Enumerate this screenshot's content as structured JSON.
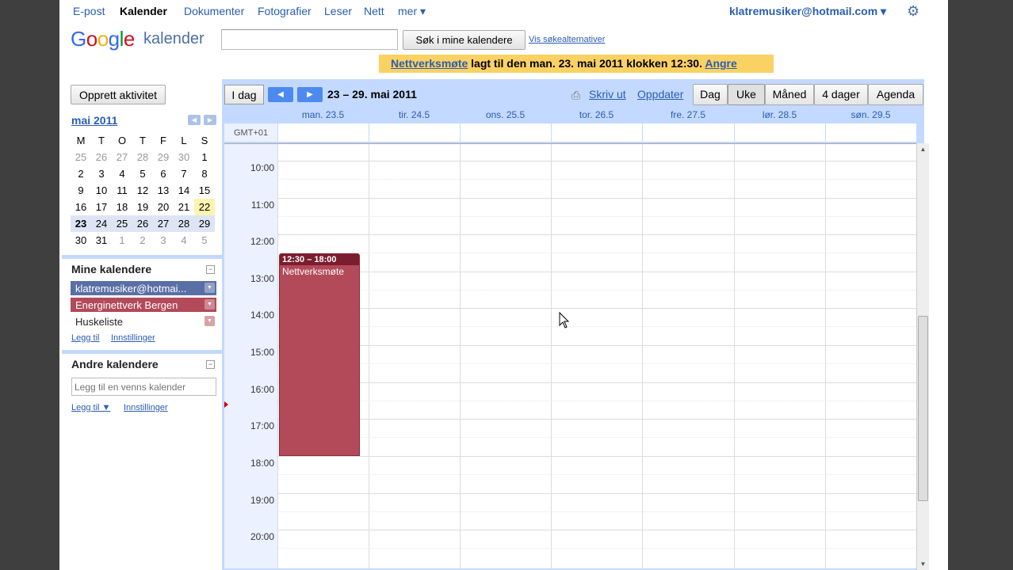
{
  "topnav": {
    "items": [
      "E-post",
      "Kalender",
      "Dokumenter",
      "Fotografier",
      "Leser",
      "Nett",
      "mer ▾"
    ],
    "account": "klatremusiker@hotmail.com ▾"
  },
  "header": {
    "logo": "Google",
    "product": "kalender",
    "search_placeholder": "",
    "search_button": "Søk i mine kalendere",
    "search_options": "Vis søkealternativer"
  },
  "notice": {
    "event_link": "Nettverksmøte",
    "text": " lagt til den man. 23. mai 2011 klokken 12:30. ",
    "undo": "Angre"
  },
  "sidebar": {
    "create_button": "Opprett aktivitet",
    "mini_cal": {
      "month": "mai 2011",
      "weekdays": [
        "M",
        "T",
        "O",
        "T",
        "F",
        "L",
        "S"
      ],
      "weeks": [
        [
          "25",
          "26",
          "27",
          "28",
          "29",
          "30",
          "1"
        ],
        [
          "2",
          "3",
          "4",
          "5",
          "6",
          "7",
          "8"
        ],
        [
          "9",
          "10",
          "11",
          "12",
          "13",
          "14",
          "15"
        ],
        [
          "16",
          "17",
          "18",
          "19",
          "20",
          "21",
          "22"
        ],
        [
          "23",
          "24",
          "25",
          "26",
          "27",
          "28",
          "29"
        ],
        [
          "30",
          "31",
          "1",
          "2",
          "3",
          "4",
          "5"
        ]
      ]
    },
    "my_calendars": {
      "title": "Mine kalendere",
      "items": [
        {
          "label": "klatremusiker@hotmai...",
          "color": "#5a6fa5"
        },
        {
          "label": "Energinettverk Bergen",
          "color": "#b24a5a"
        },
        {
          "label": "Huskeliste",
          "color": "#ffffff"
        }
      ],
      "add": "Legg til",
      "settings": "Innstillinger"
    },
    "other_calendars": {
      "title": "Andre kalendere",
      "placeholder": "Legg til en venns kalender",
      "add": "Legg til ▼",
      "settings": "Innstillinger"
    }
  },
  "toolbar": {
    "today": "I dag",
    "date_range": "23 – 29. mai 2011",
    "print": "Skriv ut",
    "refresh": "Oppdater",
    "views": [
      "Dag",
      "Uke",
      "Måned",
      "4 dager",
      "Agenda"
    ],
    "selected_view": "Uke"
  },
  "week": {
    "days": [
      "man. 23.5",
      "tir. 24.5",
      "ons. 25.5",
      "tor. 26.5",
      "fre. 27.5",
      "lør. 28.5",
      "søn. 29.5"
    ],
    "timezone": "GMT+01",
    "hours": [
      "10:00",
      "11:00",
      "12:00",
      "13:00",
      "14:00",
      "15:00",
      "16:00",
      "17:00",
      "18:00",
      "19:00",
      "20:00"
    ]
  },
  "event": {
    "time": "12:30 – 18:00",
    "title": "Nettverksmøte",
    "color": "#b24a5a"
  }
}
